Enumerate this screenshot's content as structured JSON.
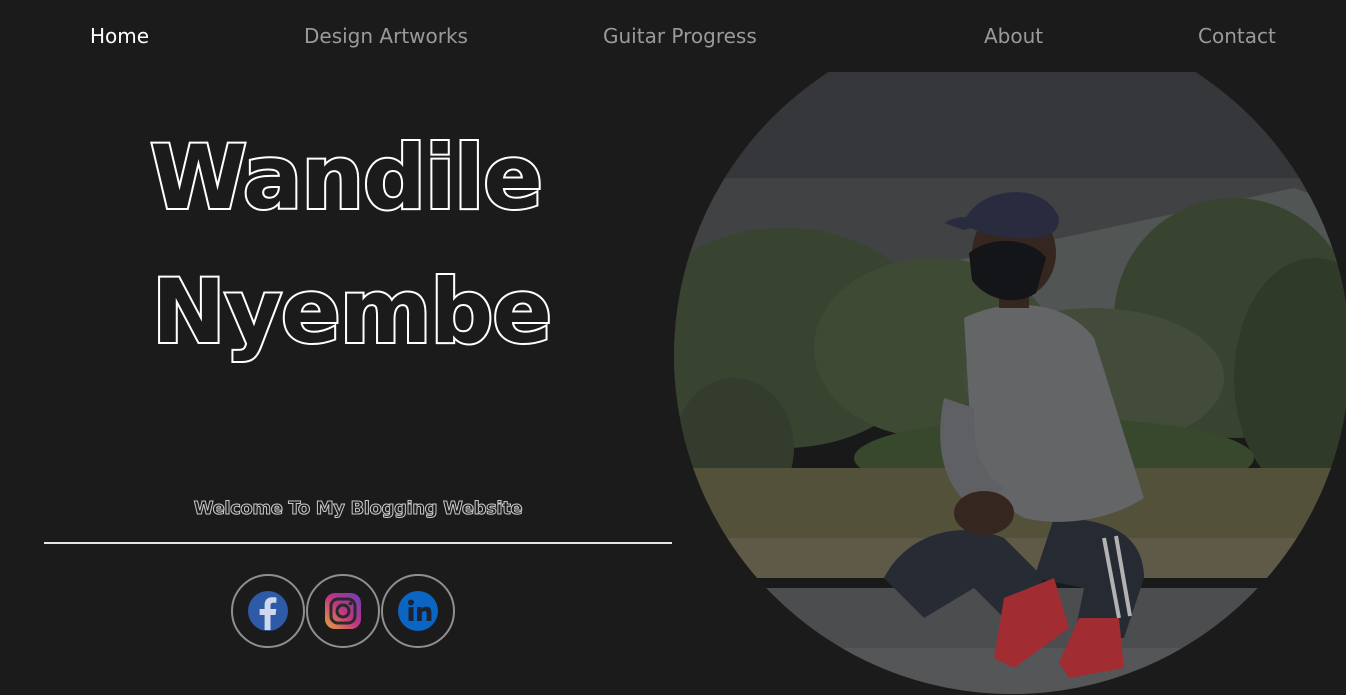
{
  "nav": {
    "items": [
      {
        "label": "Home",
        "active": true
      },
      {
        "label": "Design Artworks",
        "active": false
      },
      {
        "label": "Guitar Progress",
        "active": false
      },
      {
        "label": "About",
        "active": false
      },
      {
        "label": "Contact",
        "active": false
      }
    ]
  },
  "hero": {
    "first_name": "Wandile",
    "last_name": "Nyembe",
    "welcome": "Welcome To My Blogging Website"
  },
  "social": [
    {
      "icon": "facebook-icon",
      "color": "#2f5aa8"
    },
    {
      "icon": "instagram-icon",
      "color": "#c13584"
    },
    {
      "icon": "linkedin-icon",
      "color": "#0a66c2"
    }
  ],
  "colors": {
    "background": "#1b1b1b",
    "nav_active": "#ffffff",
    "nav_inactive": "#9a9a9a",
    "text_outline": "#ffffff"
  }
}
